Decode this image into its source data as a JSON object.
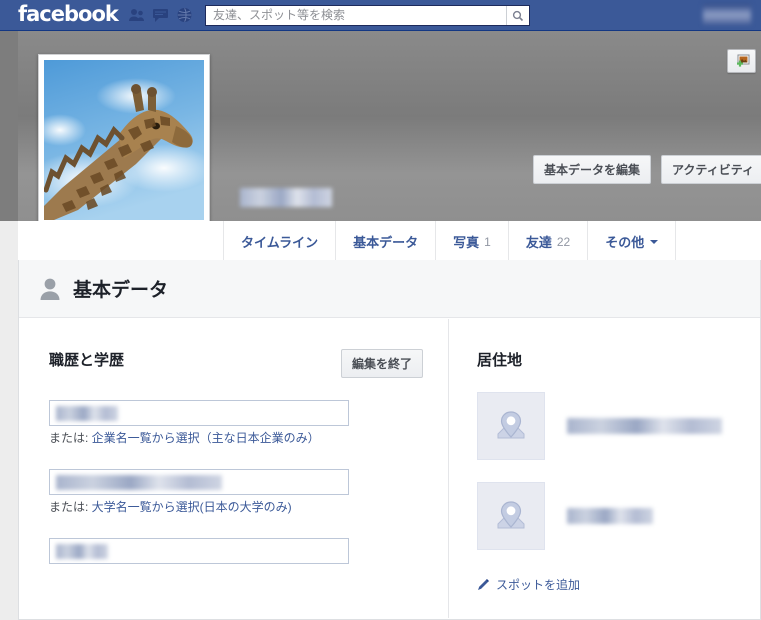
{
  "chrome": {
    "logo": "facebook",
    "icons": [
      {
        "name": "friend-requests-icon"
      },
      {
        "name": "messages-icon"
      },
      {
        "name": "notifications-globe-icon"
      }
    ],
    "search": {
      "placeholder": "友達、スポット等を検索",
      "value": "",
      "button_icon": "search-icon"
    },
    "account_menu_redacted": true,
    "colors": {
      "bar": "#3b5998",
      "bar_border": "#133783"
    }
  },
  "cover": {
    "add_photo_button_icon": "add-photo-icon",
    "profile_name_redacted": true,
    "profile_photo_alt": "giraffe-profile-photo"
  },
  "tabs": [
    {
      "label": "タイムライン",
      "count": "",
      "caret": false
    },
    {
      "label": "基本データ",
      "count": "",
      "caret": false
    },
    {
      "label": "写真",
      "count": "1",
      "caret": false
    },
    {
      "label": "友達",
      "count": "22",
      "caret": false
    },
    {
      "label": "その他",
      "count": "",
      "caret": true
    }
  ],
  "action_buttons": [
    {
      "label": "基本データを編集"
    },
    {
      "label": "アクティビティ"
    }
  ],
  "panel": {
    "icon": "person-icon",
    "title": "基本データ",
    "left": {
      "section_title": "職歴と学歴",
      "edit_button": "編集を終了",
      "fields": [
        {
          "name": "employer-input",
          "value_redacted": true,
          "note_prefix": "または: ",
          "note_link": "企業名一覧から選択（主な日本企業のみ）"
        },
        {
          "name": "university-input",
          "value_redacted": true,
          "note_prefix": "または: ",
          "note_link": "大学名一覧から選択(日本の大学のみ)"
        },
        {
          "name": "highschool-input",
          "value_redacted": true,
          "note_prefix": "",
          "note_link": ""
        }
      ]
    },
    "right": {
      "section_title": "居住地",
      "places": [
        {
          "name": "current-city",
          "icon": "map-pin-icon",
          "label_redacted": true
        },
        {
          "name": "hometown",
          "icon": "map-pin-icon",
          "label_redacted": true
        }
      ],
      "add_link": {
        "icon": "pencil-icon",
        "label": "スポットを追加"
      }
    }
  },
  "colors": {
    "accent": "#3b5998",
    "page_bg": "#ededed",
    "panel_bg": "#ffffff",
    "header_bg": "#f6f7f8",
    "border": "#dddfe2"
  }
}
